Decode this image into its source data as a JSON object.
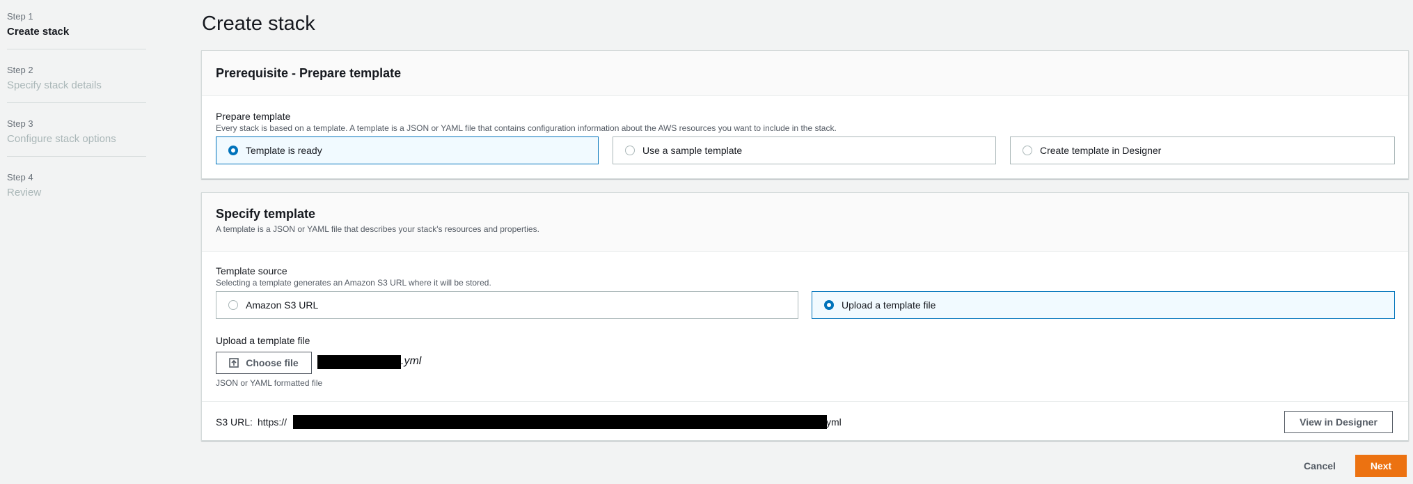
{
  "steps": [
    {
      "num": "Step 1",
      "title": "Create stack"
    },
    {
      "num": "Step 2",
      "title": "Specify stack details"
    },
    {
      "num": "Step 3",
      "title": "Configure stack options"
    },
    {
      "num": "Step 4",
      "title": "Review"
    }
  ],
  "page": {
    "title": "Create stack"
  },
  "prerequisite": {
    "title": "Prerequisite - Prepare template",
    "label": "Prepare template",
    "description": "Every stack is based on a template. A template is a JSON or YAML file that contains configuration information about the AWS resources you want to include in the stack.",
    "options": [
      "Template is ready",
      "Use a sample template",
      "Create template in Designer"
    ],
    "selected": "Template is ready"
  },
  "specify": {
    "title": "Specify template",
    "description": "A template is a JSON or YAML file that describes your stack's resources and properties.",
    "source_label": "Template source",
    "source_description": "Selecting a template generates an Amazon S3 URL where it will be stored.",
    "source_options": [
      "Amazon S3 URL",
      "Upload a template file"
    ],
    "source_selected": "Upload a template file",
    "upload_label": "Upload a template file",
    "choose_file_label": "Choose file",
    "file_name_suffix": ".yml",
    "file_hint": "JSON or YAML formatted file",
    "s3_url_label": "S3 URL:",
    "s3_url_prefix": "https://",
    "s3_url_suffix": "yml",
    "view_in_designer_label": "View in Designer"
  },
  "footer": {
    "cancel_label": "Cancel",
    "next_label": "Next"
  },
  "colors": {
    "accent": "#0073bb",
    "primary": "#ec7211",
    "background": "#f2f3f3"
  },
  "icons": {
    "choose_file": "upload-icon"
  }
}
